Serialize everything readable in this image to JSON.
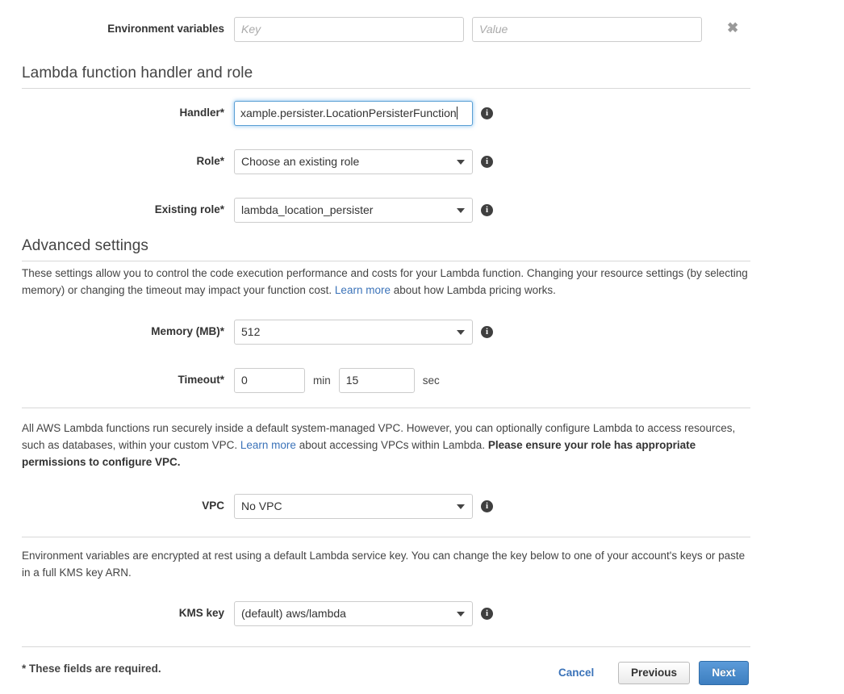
{
  "env_vars": {
    "label": "Environment variables",
    "key_placeholder": "Key",
    "value_placeholder": "Value",
    "key_value": "",
    "value_value": "",
    "remove_icon": "✖"
  },
  "handler_section": {
    "heading": "Lambda function handler and role",
    "handler": {
      "label": "Handler*",
      "value": "xample.persister.LocationPersisterFunction"
    },
    "role": {
      "label": "Role*",
      "value": "Choose an existing role"
    },
    "existing_role": {
      "label": "Existing role*",
      "value": "lambda_location_persister"
    }
  },
  "advanced": {
    "heading": "Advanced settings",
    "description_part1": "These settings allow you to control the code execution performance and costs for your Lambda function. Changing your resource settings (by selecting memory) or changing the timeout may impact your function cost. ",
    "description_link": "Learn more",
    "description_part2": " about how Lambda pricing works.",
    "memory": {
      "label": "Memory (MB)*",
      "value": "512"
    },
    "timeout": {
      "label": "Timeout*",
      "minutes": "0",
      "min_unit": "min",
      "seconds": "15",
      "sec_unit": "sec"
    }
  },
  "vpc": {
    "description_part1": "All AWS Lambda functions run securely inside a default system-managed VPC. However, you can optionally configure Lambda to access resources, such as databases, within your custom VPC. ",
    "description_link": "Learn more",
    "description_part2": " about accessing VPCs within Lambda. ",
    "description_bold": "Please ensure your role has appropriate permissions to configure VPC.",
    "label": "VPC",
    "value": "No VPC"
  },
  "kms": {
    "description": "Environment variables are encrypted at rest using a default Lambda service key. You can change the key below to one of your account's keys or paste in a full KMS key ARN.",
    "label": "KMS key",
    "value": "(default) aws/lambda"
  },
  "footer": {
    "required_note": "* These fields are required.",
    "cancel_label": "Cancel",
    "previous_label": "Previous",
    "next_label": "Next"
  },
  "colors": {
    "link": "#3b73b9",
    "primary_button": "#3d7ec0",
    "focus_border": "#5a9fd4",
    "info_icon": "#3f3f3f"
  }
}
